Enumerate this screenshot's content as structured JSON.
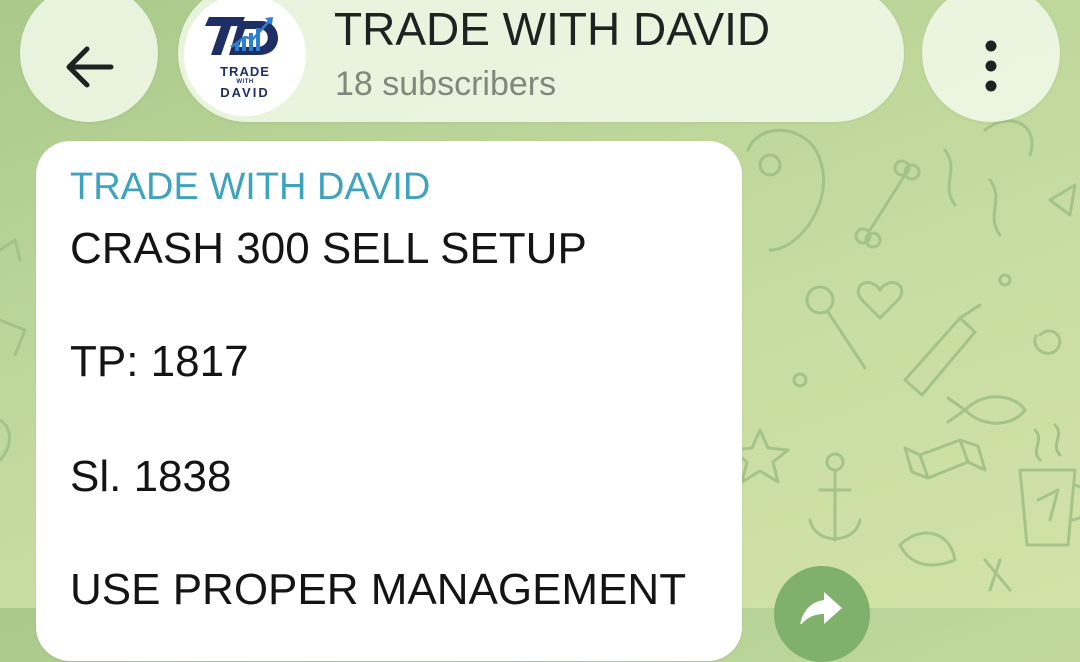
{
  "header": {
    "back_icon": "arrow-left-icon",
    "channel_name": "TRADE WITH DAVID",
    "subscriber_count": "18 subscribers",
    "menu_icon": "more-vertical-icon",
    "avatar": {
      "logo_line1": "TRADE",
      "logo_line2": "WITH",
      "logo_line3": "DAVID"
    }
  },
  "message": {
    "sender": "TRADE WITH DAVID",
    "lines": [
      "CRASH 300 SELL SETUP",
      "TP: 1817",
      "Sl. 1838",
      "USE PROPER MANAGEMENT"
    ]
  },
  "actions": {
    "share_icon": "forward-arrow-icon"
  },
  "colors": {
    "sender_name": "#3ea3bd",
    "share_button": "#7fb06c",
    "wallpaper": "#bcd69a",
    "logo_navy": "#1f2f66",
    "logo_blue": "#2f7fd0"
  }
}
